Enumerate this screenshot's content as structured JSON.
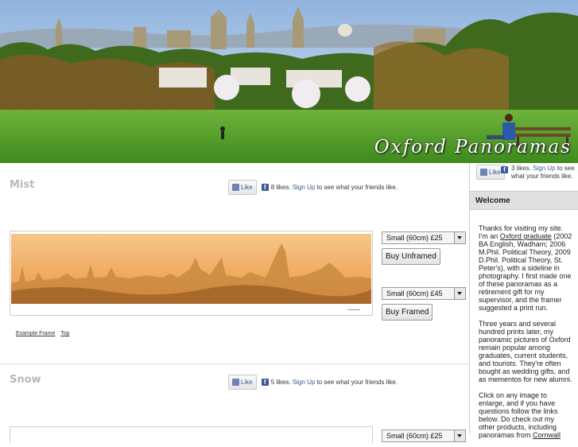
{
  "site": {
    "brand": "Oxford Panoramas"
  },
  "sections": [
    {
      "title": "Mist",
      "facebook": {
        "like": "Like",
        "count_text": "8 likes.",
        "signup": "Sign Up",
        "suffix": "to see what your friends like."
      },
      "unframed": {
        "size_option": "Small (60cm) £25",
        "button": "Buy Unframed"
      },
      "framed": {
        "size_option": "Small (60cm) £45",
        "button": "Buy Framed"
      },
      "links": [
        "Example Frame",
        "Top"
      ]
    },
    {
      "title": "Snow",
      "facebook": {
        "like": "Like",
        "count_text": "5 likes.",
        "signup": "Sign Up",
        "suffix": "to see what your friends like."
      },
      "unframed": {
        "size_option": "Small (60cm) £25"
      }
    }
  ],
  "sidebar": {
    "facebook": {
      "like": "Like",
      "count_text": "3 likes.",
      "signup": "Sign Up",
      "suffix": "to see what your friends like."
    },
    "heading": "Welcome",
    "p1_pre": "Thanks for visiting my site. I'm an ",
    "p1_link": "Oxford graduate",
    "p1_post": " (2002 BA English, Wadham; 2006 M.Phil. Political Theory, 2009 D.Phil. Political Theory, St. Peter's), with a sideline in photography. I first made one of these panoramas as a retirement gift for my supervisor, and the framer suggested a print run.",
    "p2": "Three years and several hundred prints later, my panoramic pictures of Oxford remain popular among graduates, current students, and tourists. They're often bought as wedding gifts, and as mementos for new alumni.",
    "p3_pre": "Click on any image to enlarge, and if you have questions follow the links below. Do check out my other products, including panoramas from ",
    "p3_link": "Cornwall"
  },
  "colors": {
    "fb_blue": "#3b5998",
    "mist_sky": "#f3b46a",
    "grass": "#4f9a2c"
  },
  "icons": {
    "like": "thumbs-up-icon",
    "facebook": "facebook-f-icon",
    "dropdown": "chevron-down-icon"
  }
}
